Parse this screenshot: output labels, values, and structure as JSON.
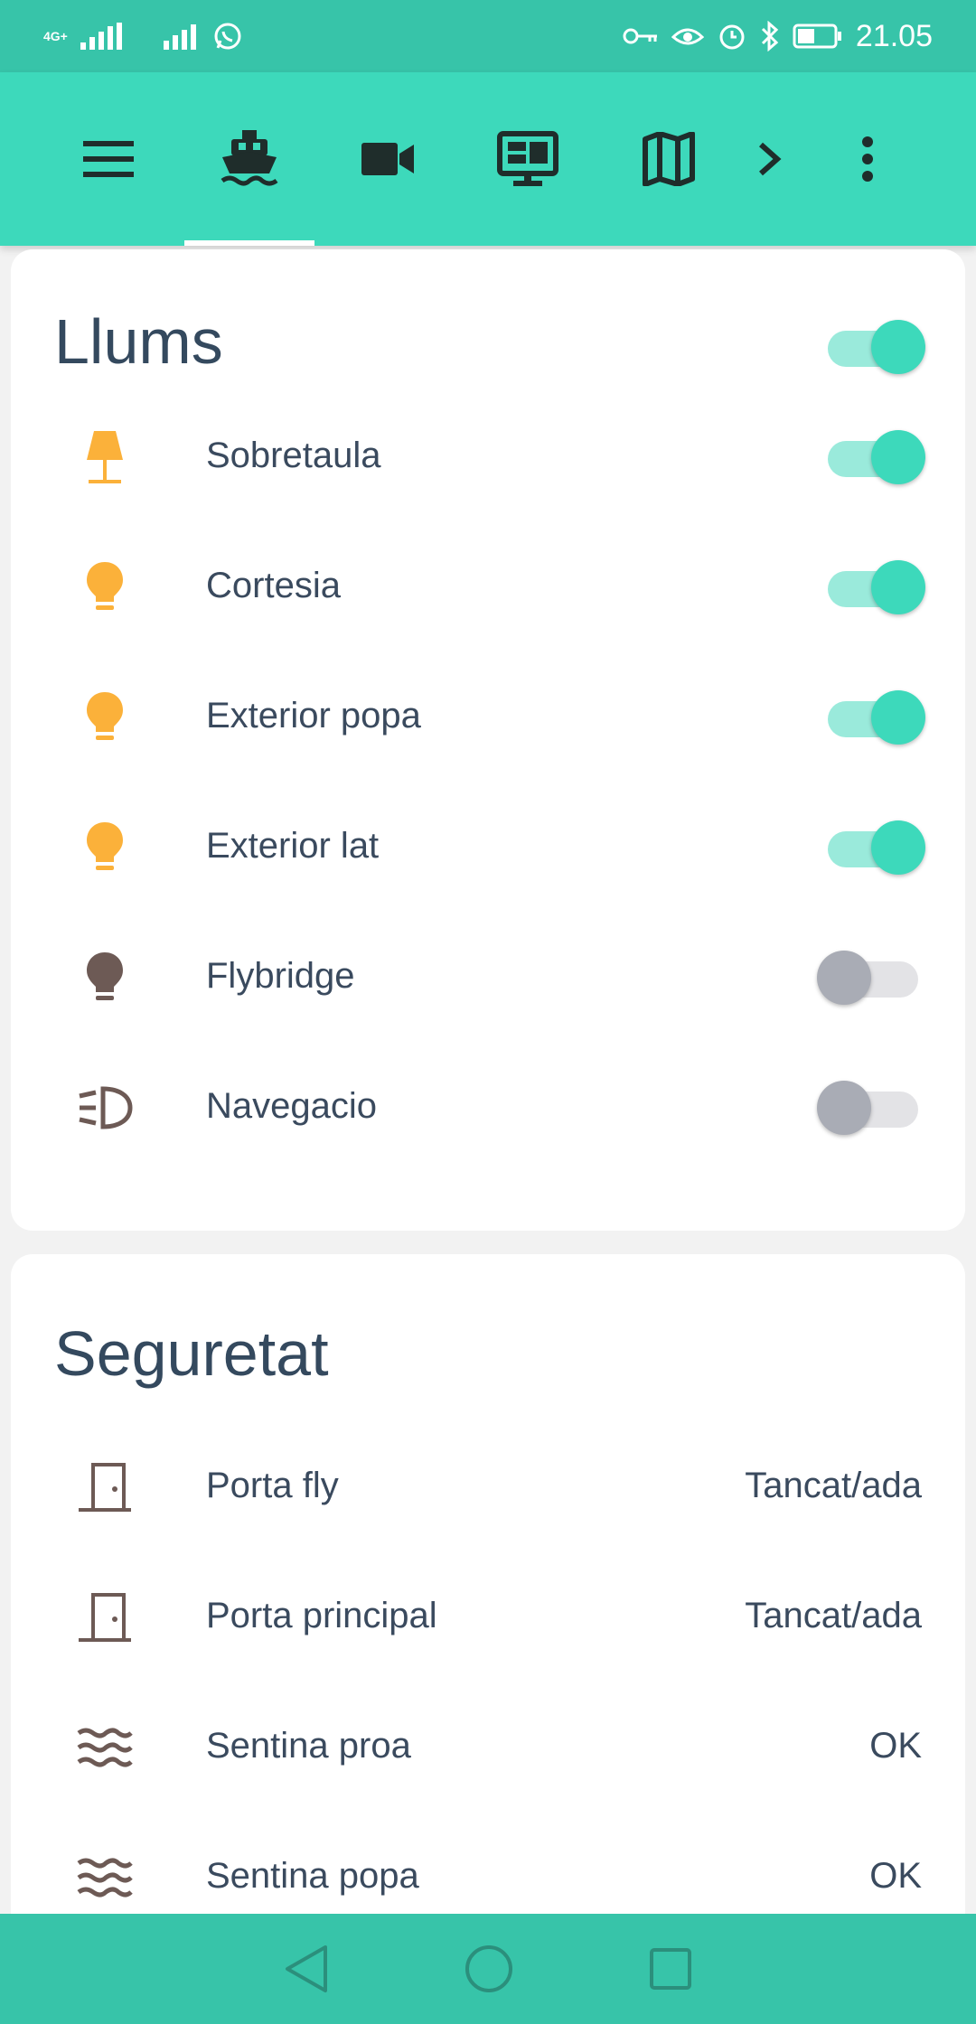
{
  "status_bar": {
    "network_label": "4G+",
    "time": "21.05"
  },
  "app_bar": {
    "tabs": [
      {
        "icon": "ship-icon",
        "selected": true
      },
      {
        "icon": "video-camera-icon",
        "selected": false
      },
      {
        "icon": "monitor-dashboard-icon",
        "selected": false
      },
      {
        "icon": "map-icon",
        "selected": false
      }
    ],
    "accent_color": "#3dd9bb",
    "status_color": "#37c4a9"
  },
  "lights_card": {
    "title": "Llums",
    "master_toggle": true,
    "items": [
      {
        "label": "Sobretaula",
        "icon": "table-lamp-icon",
        "on": true
      },
      {
        "label": "Cortesia",
        "icon": "lightbulb-icon",
        "on": true
      },
      {
        "label": "Exterior popa",
        "icon": "lightbulb-icon",
        "on": true
      },
      {
        "label": "Exterior lat",
        "icon": "lightbulb-icon",
        "on": true
      },
      {
        "label": "Flybridge",
        "icon": "lightbulb-icon",
        "on": false
      },
      {
        "label": "Navegacio",
        "icon": "headlight-icon",
        "on": false
      }
    ]
  },
  "security_card": {
    "title": "Seguretat",
    "items": [
      {
        "label": "Porta fly",
        "icon": "door-icon",
        "value": "Tancat/ada"
      },
      {
        "label": "Porta principal",
        "icon": "door-icon",
        "value": "Tancat/ada"
      },
      {
        "label": "Sentina proa",
        "icon": "water-waves-icon",
        "value": "OK"
      },
      {
        "label": "Sentina popa",
        "icon": "water-waves-icon",
        "value": "OK"
      }
    ]
  }
}
